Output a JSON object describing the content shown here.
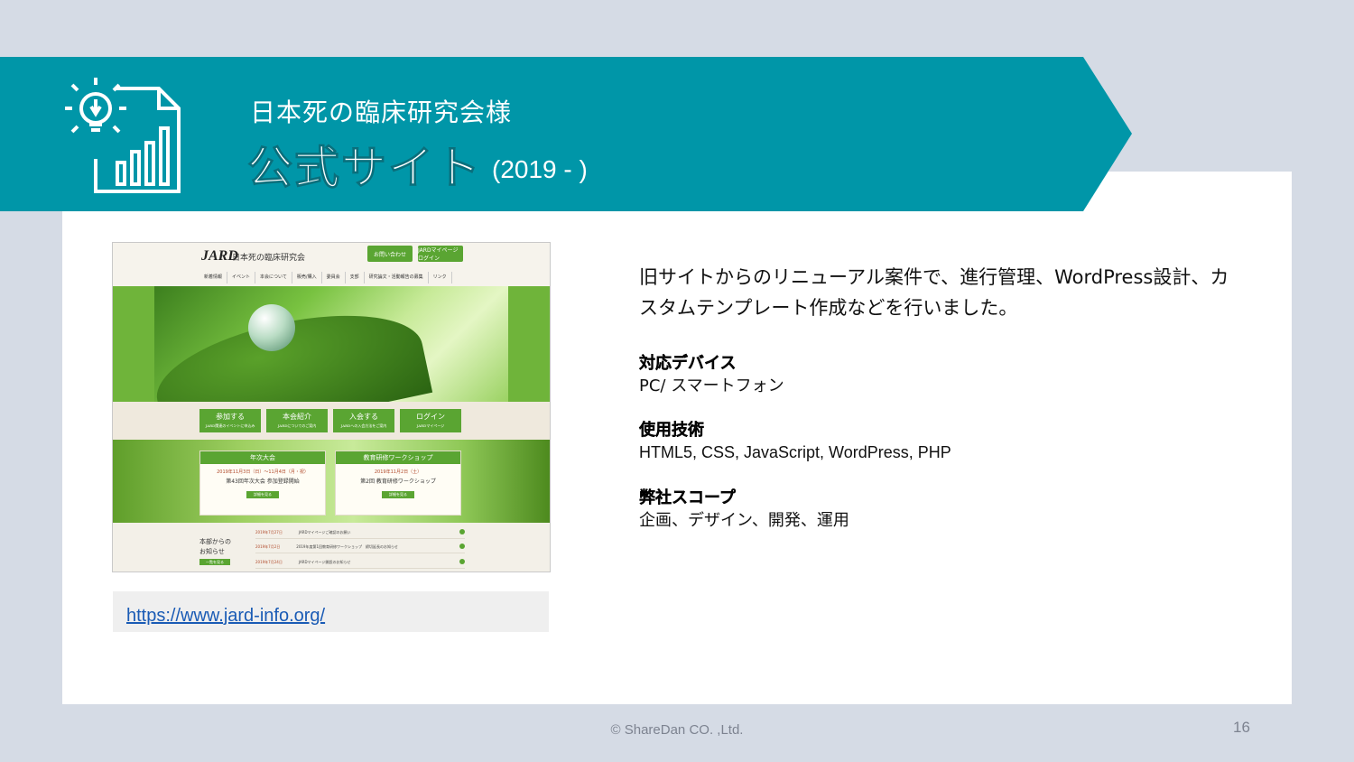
{
  "header": {
    "subtitle": "日本死の臨床研究会様",
    "title": "公式サイト",
    "year": "(2019 - )",
    "accent_color": "#0096a8",
    "icon": "lightbulb-chart-icon"
  },
  "screenshot": {
    "logo": "JARD",
    "org_name": "日本死の臨床研究会",
    "top_buttons": [
      "お問い合わせ",
      "JARDマイページログイン"
    ],
    "nav": [
      "新着情報",
      "イベント",
      "本会について",
      "販売/購入",
      "委員会",
      "支部",
      "研究論文・活動報告の募集",
      "リンク"
    ],
    "buttons": [
      {
        "label": "参加する",
        "sub": "JARD関連のイベントに申込み"
      },
      {
        "label": "本会紹介",
        "sub": "JARDについてのご案内"
      },
      {
        "label": "入会する",
        "sub": "JARDへの入会方法をご案内"
      },
      {
        "label": "ログイン",
        "sub": "JARDマイページ"
      }
    ],
    "events": [
      {
        "head": "年次大会",
        "date": "2019年11月3日（日）〜11月4日（月・祝）",
        "title": "第43回年次大会 参加登録開始",
        "btn": "詳細を見る"
      },
      {
        "head": "教育研修ワークショップ",
        "date": "2019年11月2日（土）",
        "title": "第2回 教育研修ワークショップ",
        "btn": "詳細を見る"
      }
    ],
    "news_label_1": "本部からの",
    "news_label_2": "お知らせ",
    "news_more": "一覧を見る",
    "news": [
      {
        "date": "2019年7月27日",
        "text": "JARDマイページご確認のお願い"
      },
      {
        "date": "2019年7月2日",
        "text": "2019年度第1回教育研修ワークショップ　締切延長のお知らせ"
      },
      {
        "date": "2019年7月24日",
        "text": "JARDマイページ開設のお知らせ"
      }
    ]
  },
  "url": "https://www.jard-info.org/",
  "description": "旧サイトからのリニューアル案件で、進行管理、WordPress設計、カスタムテンプレート作成などを行いました。",
  "sections": [
    {
      "key": "対応デバイス",
      "value": "PC/ スマートフォン"
    },
    {
      "key": "使用技術",
      "value": "HTML5, CSS, JavaScript, WordPress, PHP"
    },
    {
      "key": "弊社スコープ",
      "value": "企画、デザイン、開発、運用"
    }
  ],
  "footer": "© ShareDan CO. ,Ltd.",
  "page_number": "16"
}
